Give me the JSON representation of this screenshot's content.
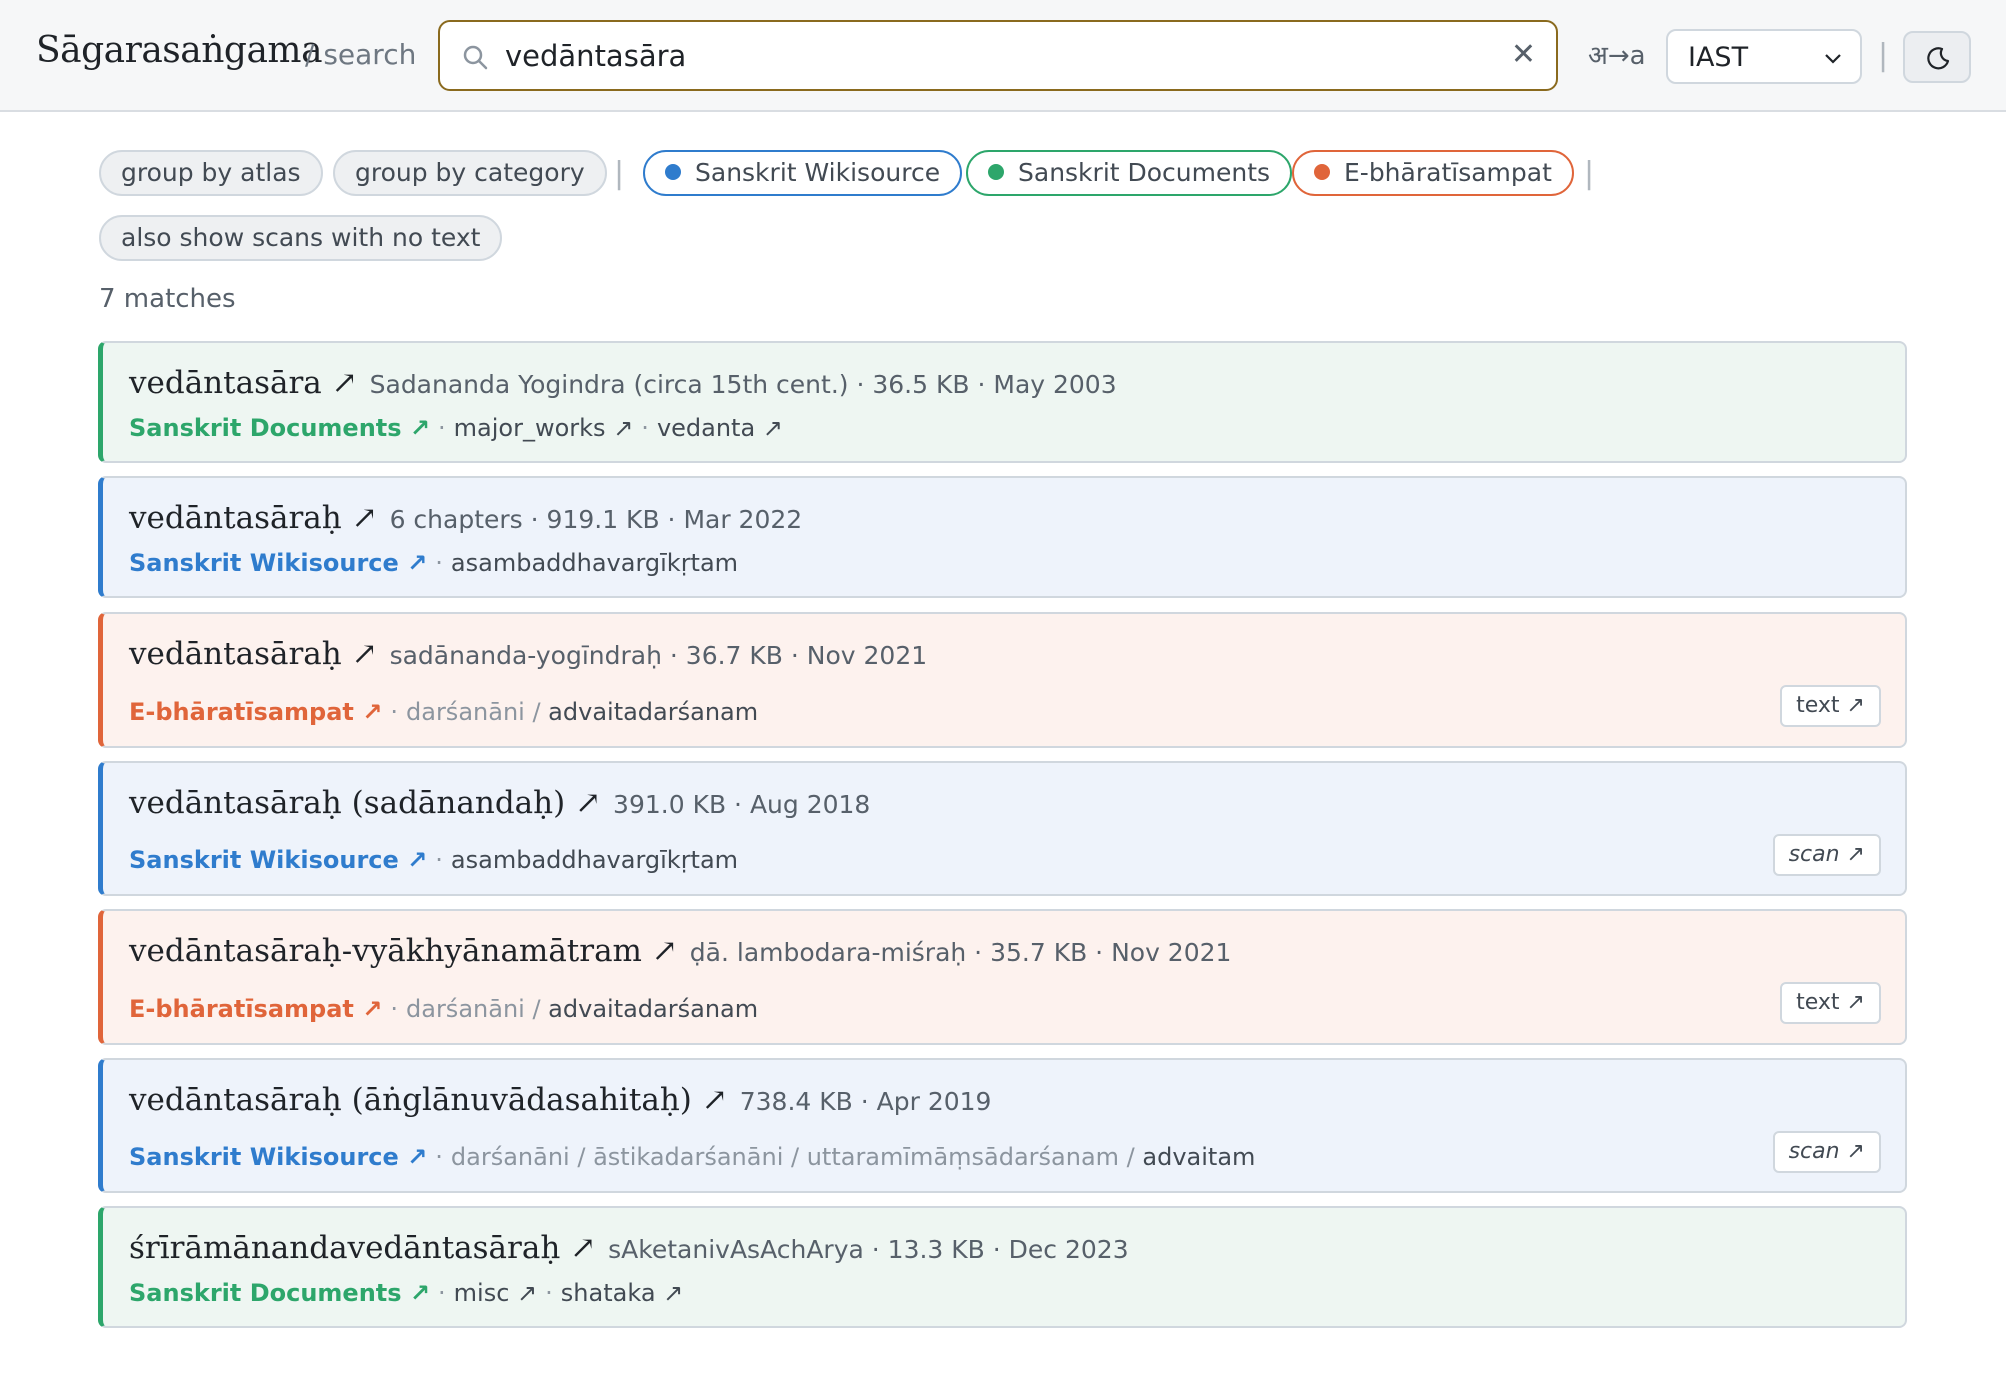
{
  "header": {
    "brand": "Sāgarasaṅgama",
    "subtitle": "/ search",
    "search_value": "vedāntasāra",
    "clear_glyph": "✕",
    "translit_label": "अ→a",
    "script_value": "IAST",
    "separator": "|"
  },
  "filters": {
    "group_by_atlas": "group by atlas",
    "group_by_category": "group by category",
    "sources": [
      {
        "label": "Sanskrit Wikisource",
        "color": "#2f7ccd"
      },
      {
        "label": "Sanskrit Documents",
        "color": "#2da66b"
      },
      {
        "label": "E-bhāratīsampat",
        "color": "#e0653a"
      }
    ],
    "show_scans": "also show scans with no text",
    "separator": "|"
  },
  "results_count": "7 matches",
  "results": [
    {
      "title": "vedāntasāra ↗",
      "meta": "Sadananda Yogindra (circa 15th cent.) · 36.5 KB · May 2003",
      "source": "Sanskrit Documents ↗",
      "dot": "·",
      "c1": "major_works ↗",
      "dot2": "·",
      "c2": "vedanta ↗"
    },
    {
      "title": "vedāntasāraḥ ↗",
      "meta": "6 chapters · 919.1 KB · Mar 2022",
      "source": "Sanskrit Wikisource ↗",
      "dot": "·",
      "c1": "asambaddhavargīkṛtam"
    },
    {
      "title": "vedāntasāraḥ ↗",
      "meta": "sadānanda-yogīndraḥ · 36.7 KB · Nov 2021",
      "source": "E-bhāratīsampat ↗",
      "dot": "·",
      "c1": "darśanāni /",
      "c2": "advaitadarśanam",
      "tag": "text ↗"
    },
    {
      "title": "vedāntasāraḥ (sadānandaḥ) ↗",
      "meta": "391.0 KB · Aug 2018",
      "source": "Sanskrit Wikisource ↗",
      "dot": "·",
      "c1": "asambaddhavargīkṛtam",
      "tag": "scan ↗"
    },
    {
      "title": "vedāntasāraḥ-vyākhyānamātram ↗",
      "meta": "ḍā. lambodara-miśraḥ · 35.7 KB · Nov 2021",
      "source": "E-bhāratīsampat ↗",
      "dot": "·",
      "c1": "darśanāni /",
      "c2": "advaitadarśanam",
      "tag": "text ↗"
    },
    {
      "title": "vedāntasāraḥ (āṅglānuvādasahitaḥ) ↗",
      "meta": "738.4 KB · Apr 2019",
      "source": "Sanskrit Wikisource ↗",
      "dot": "·",
      "c1": "darśanāni / āstikadarśanāni / uttaramīmāṃsādarśanam /",
      "c2": "advaitam",
      "tag": "scan ↗"
    },
    {
      "title": "śrīrāmānandavedāntasāraḥ ↗",
      "meta": "sAketanivAsAchArya · 13.3 KB · Dec 2023",
      "source": "Sanskrit Documents ↗",
      "dot": "·",
      "c1": "misc ↗",
      "dot2": "·",
      "c2": "shataka ↗"
    }
  ]
}
